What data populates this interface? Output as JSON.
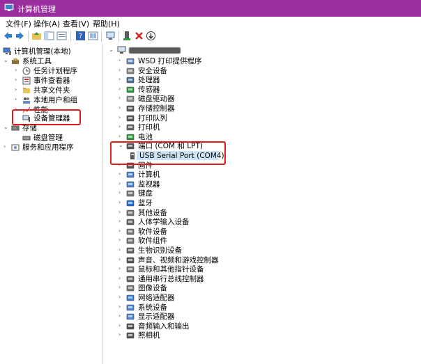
{
  "window": {
    "title": "计算机管理"
  },
  "menu": [
    "文件(F)",
    "操作(A)",
    "查看(V)",
    "帮助(H)"
  ],
  "left_tree": {
    "root": "计算机管理(本地)",
    "system_tools": "系统工具",
    "task_scheduler": "任务计划程序",
    "event_viewer": "事件查看器",
    "shared_folders": "共享文件夹",
    "local_users": "本地用户和组",
    "performance": "性能",
    "device_manager": "设备管理器",
    "storage": "存储",
    "disk_management": "磁盘管理",
    "services_apps": "服务和应用程序"
  },
  "device_categories": [
    "WSD 打印提供程序",
    "安全设备",
    "处理器",
    "传感器",
    "磁盘驱动器",
    "存储控制器",
    "打印队列",
    "打印机",
    "电池",
    "端口 (COM 和 LPT)",
    "固件",
    "计算机",
    "监视器",
    "键盘",
    "蓝牙",
    "其他设备",
    "人体学输入设备",
    "软件设备",
    "软件组件",
    "生物识别设备",
    "声音、视频和游戏控制器",
    "鼠标和其他指针设备",
    "通用串行总线控制器",
    "图像设备",
    "网络适配器",
    "系统设备",
    "显示适配器",
    "音频输入和输出",
    "照相机"
  ],
  "port_child": "USB Serial Port (COM4)",
  "colors": {
    "title_bar": "#9a2e9c",
    "highlight": "#e01b1b",
    "selection": "#cce4f7"
  }
}
